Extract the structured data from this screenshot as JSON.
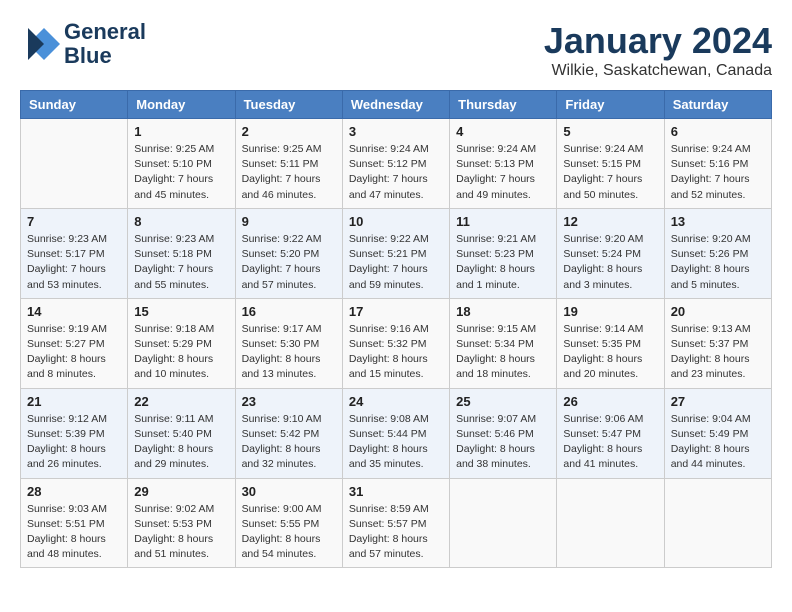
{
  "header": {
    "logo_line1": "General",
    "logo_line2": "Blue",
    "month": "January 2024",
    "location": "Wilkie, Saskatchewan, Canada"
  },
  "weekdays": [
    "Sunday",
    "Monday",
    "Tuesday",
    "Wednesday",
    "Thursday",
    "Friday",
    "Saturday"
  ],
  "weeks": [
    [
      {
        "day": "",
        "info": ""
      },
      {
        "day": "1",
        "info": "Sunrise: 9:25 AM\nSunset: 5:10 PM\nDaylight: 7 hours\nand 45 minutes."
      },
      {
        "day": "2",
        "info": "Sunrise: 9:25 AM\nSunset: 5:11 PM\nDaylight: 7 hours\nand 46 minutes."
      },
      {
        "day": "3",
        "info": "Sunrise: 9:24 AM\nSunset: 5:12 PM\nDaylight: 7 hours\nand 47 minutes."
      },
      {
        "day": "4",
        "info": "Sunrise: 9:24 AM\nSunset: 5:13 PM\nDaylight: 7 hours\nand 49 minutes."
      },
      {
        "day": "5",
        "info": "Sunrise: 9:24 AM\nSunset: 5:15 PM\nDaylight: 7 hours\nand 50 minutes."
      },
      {
        "day": "6",
        "info": "Sunrise: 9:24 AM\nSunset: 5:16 PM\nDaylight: 7 hours\nand 52 minutes."
      }
    ],
    [
      {
        "day": "7",
        "info": "Sunrise: 9:23 AM\nSunset: 5:17 PM\nDaylight: 7 hours\nand 53 minutes."
      },
      {
        "day": "8",
        "info": "Sunrise: 9:23 AM\nSunset: 5:18 PM\nDaylight: 7 hours\nand 55 minutes."
      },
      {
        "day": "9",
        "info": "Sunrise: 9:22 AM\nSunset: 5:20 PM\nDaylight: 7 hours\nand 57 minutes."
      },
      {
        "day": "10",
        "info": "Sunrise: 9:22 AM\nSunset: 5:21 PM\nDaylight: 7 hours\nand 59 minutes."
      },
      {
        "day": "11",
        "info": "Sunrise: 9:21 AM\nSunset: 5:23 PM\nDaylight: 8 hours\nand 1 minute."
      },
      {
        "day": "12",
        "info": "Sunrise: 9:20 AM\nSunset: 5:24 PM\nDaylight: 8 hours\nand 3 minutes."
      },
      {
        "day": "13",
        "info": "Sunrise: 9:20 AM\nSunset: 5:26 PM\nDaylight: 8 hours\nand 5 minutes."
      }
    ],
    [
      {
        "day": "14",
        "info": "Sunrise: 9:19 AM\nSunset: 5:27 PM\nDaylight: 8 hours\nand 8 minutes."
      },
      {
        "day": "15",
        "info": "Sunrise: 9:18 AM\nSunset: 5:29 PM\nDaylight: 8 hours\nand 10 minutes."
      },
      {
        "day": "16",
        "info": "Sunrise: 9:17 AM\nSunset: 5:30 PM\nDaylight: 8 hours\nand 13 minutes."
      },
      {
        "day": "17",
        "info": "Sunrise: 9:16 AM\nSunset: 5:32 PM\nDaylight: 8 hours\nand 15 minutes."
      },
      {
        "day": "18",
        "info": "Sunrise: 9:15 AM\nSunset: 5:34 PM\nDaylight: 8 hours\nand 18 minutes."
      },
      {
        "day": "19",
        "info": "Sunrise: 9:14 AM\nSunset: 5:35 PM\nDaylight: 8 hours\nand 20 minutes."
      },
      {
        "day": "20",
        "info": "Sunrise: 9:13 AM\nSunset: 5:37 PM\nDaylight: 8 hours\nand 23 minutes."
      }
    ],
    [
      {
        "day": "21",
        "info": "Sunrise: 9:12 AM\nSunset: 5:39 PM\nDaylight: 8 hours\nand 26 minutes."
      },
      {
        "day": "22",
        "info": "Sunrise: 9:11 AM\nSunset: 5:40 PM\nDaylight: 8 hours\nand 29 minutes."
      },
      {
        "day": "23",
        "info": "Sunrise: 9:10 AM\nSunset: 5:42 PM\nDaylight: 8 hours\nand 32 minutes."
      },
      {
        "day": "24",
        "info": "Sunrise: 9:08 AM\nSunset: 5:44 PM\nDaylight: 8 hours\nand 35 minutes."
      },
      {
        "day": "25",
        "info": "Sunrise: 9:07 AM\nSunset: 5:46 PM\nDaylight: 8 hours\nand 38 minutes."
      },
      {
        "day": "26",
        "info": "Sunrise: 9:06 AM\nSunset: 5:47 PM\nDaylight: 8 hours\nand 41 minutes."
      },
      {
        "day": "27",
        "info": "Sunrise: 9:04 AM\nSunset: 5:49 PM\nDaylight: 8 hours\nand 44 minutes."
      }
    ],
    [
      {
        "day": "28",
        "info": "Sunrise: 9:03 AM\nSunset: 5:51 PM\nDaylight: 8 hours\nand 48 minutes."
      },
      {
        "day": "29",
        "info": "Sunrise: 9:02 AM\nSunset: 5:53 PM\nDaylight: 8 hours\nand 51 minutes."
      },
      {
        "day": "30",
        "info": "Sunrise: 9:00 AM\nSunset: 5:55 PM\nDaylight: 8 hours\nand 54 minutes."
      },
      {
        "day": "31",
        "info": "Sunrise: 8:59 AM\nSunset: 5:57 PM\nDaylight: 8 hours\nand 57 minutes."
      },
      {
        "day": "",
        "info": ""
      },
      {
        "day": "",
        "info": ""
      },
      {
        "day": "",
        "info": ""
      }
    ]
  ]
}
